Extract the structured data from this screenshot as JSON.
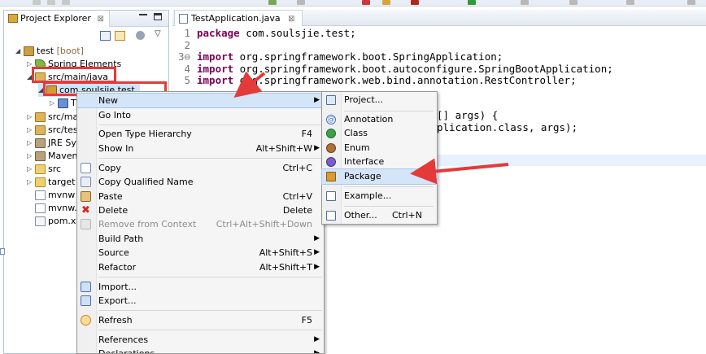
{
  "explorer": {
    "tab_label": "Project Explorer",
    "close_glyph": "⊠",
    "tree": [
      {
        "id": "project",
        "label": "test",
        "suffix": " [boot]",
        "arrow": "◢",
        "icon": "project-icon"
      },
      {
        "id": "spring-elements",
        "label": "Spring Elements",
        "arrow": "▷",
        "icon": "spring-leaf-icon"
      },
      {
        "id": "src-main-java",
        "label": "src/main/java",
        "arrow": "◢",
        "icon": "source-folder-icon"
      },
      {
        "id": "package",
        "label": "com.soulsjie.test",
        "arrow": "◢",
        "icon": "package-icon"
      },
      {
        "id": "class-file",
        "label": "T",
        "arrow": "▷",
        "icon": "java-file-icon"
      },
      {
        "id": "src-main-2",
        "label": "src/mai",
        "arrow": "▷",
        "icon": "source-folder-icon"
      },
      {
        "id": "src-test",
        "label": "src/test",
        "arrow": "▷",
        "icon": "source-folder-icon"
      },
      {
        "id": "jre",
        "label": "JRE Sys",
        "arrow": "▷",
        "icon": "library-icon"
      },
      {
        "id": "maven",
        "label": "Maven",
        "arrow": "▷",
        "icon": "library-icon"
      },
      {
        "id": "src",
        "label": "src",
        "arrow": "▷",
        "icon": "folder-icon"
      },
      {
        "id": "target",
        "label": "target",
        "arrow": "▷",
        "icon": "folder-icon"
      },
      {
        "id": "mvnw",
        "label": "mvnw",
        "arrow": "",
        "icon": "file-icon"
      },
      {
        "id": "mvnw-cmd",
        "label": "mvnw.c",
        "arrow": "",
        "icon": "file-icon"
      },
      {
        "id": "pom",
        "label": "pom.xm",
        "arrow": "",
        "icon": "xml-file-icon"
      }
    ]
  },
  "editor": {
    "tab_label": "TestApplication.java",
    "close_glyph": "⊠",
    "lines": [
      {
        "n": "1",
        "kw": "package",
        "text": " com.soulsjie.test;"
      },
      {
        "n": "2",
        "kw": "",
        "text": ""
      },
      {
        "n": "3⊖",
        "kw": "import",
        "text": " org.springframework.boot.SpringApplication;"
      },
      {
        "n": "4",
        "kw": "import",
        "text": " org.springframework.boot.autoconfigure.SpringBootApplication;"
      },
      {
        "n": "5",
        "kw": "import",
        "text": " org.springframework.web.bind.annotation.RestController;"
      },
      {
        "n": "",
        "kw": "",
        "text": "[] args) {"
      },
      {
        "n": "",
        "kw": "",
        "text": "plication.class, args);"
      }
    ]
  },
  "context_menu": {
    "items": [
      {
        "label": "New",
        "accel": "",
        "submenu": true,
        "state": "active",
        "icon": ""
      },
      {
        "label": "Go Into",
        "accel": "",
        "submenu": false,
        "state": "normal",
        "icon": ""
      },
      {
        "label": "Open Type Hierarchy",
        "accel": "F4",
        "submenu": false,
        "state": "normal",
        "icon": ""
      },
      {
        "label": "Show In",
        "accel": "Alt+Shift+W",
        "submenu": true,
        "state": "normal",
        "icon": ""
      },
      {
        "label": "Copy",
        "accel": "Ctrl+C",
        "submenu": false,
        "state": "normal",
        "icon": "copy-icon"
      },
      {
        "label": "Copy Qualified Name",
        "accel": "",
        "submenu": false,
        "state": "normal",
        "icon": "copy-qualified-icon"
      },
      {
        "label": "Paste",
        "accel": "Ctrl+V",
        "submenu": false,
        "state": "normal",
        "icon": "paste-icon"
      },
      {
        "label": "Delete",
        "accel": "Delete",
        "submenu": false,
        "state": "normal",
        "icon": "delete-icon"
      },
      {
        "label": "Remove from Context",
        "accel": "Ctrl+Alt+Shift+Down",
        "submenu": false,
        "state": "disabled",
        "icon": "remove-context-icon"
      },
      {
        "label": "Build Path",
        "accel": "",
        "submenu": true,
        "state": "normal",
        "icon": ""
      },
      {
        "label": "Source",
        "accel": "Alt+Shift+S",
        "submenu": true,
        "state": "normal",
        "icon": ""
      },
      {
        "label": "Refactor",
        "accel": "Alt+Shift+T",
        "submenu": true,
        "state": "normal",
        "icon": ""
      },
      {
        "label": "Import...",
        "accel": "",
        "submenu": false,
        "state": "normal",
        "icon": "import-icon"
      },
      {
        "label": "Export...",
        "accel": "",
        "submenu": false,
        "state": "normal",
        "icon": "export-icon"
      },
      {
        "label": "Refresh",
        "accel": "F5",
        "submenu": false,
        "state": "normal",
        "icon": "refresh-icon"
      },
      {
        "label": "References",
        "accel": "",
        "submenu": true,
        "state": "normal",
        "icon": ""
      },
      {
        "label": "Declarations",
        "accel": "",
        "submenu": true,
        "state": "normal",
        "icon": ""
      }
    ]
  },
  "new_submenu": {
    "items": [
      {
        "label": "Project...",
        "accel": "",
        "icon": "new-project-icon"
      },
      {
        "label": "Annotation",
        "accel": "",
        "icon": "annotation-icon"
      },
      {
        "label": "Class",
        "accel": "",
        "icon": "class-icon"
      },
      {
        "label": "Enum",
        "accel": "",
        "icon": "enum-icon"
      },
      {
        "label": "Interface",
        "accel": "",
        "icon": "interface-icon"
      },
      {
        "label": "Package",
        "accel": "",
        "icon": "package-icon"
      },
      {
        "label": "Example...",
        "accel": "",
        "icon": "example-icon"
      },
      {
        "label": "Other...",
        "accel": "Ctrl+N",
        "icon": "other-wizard-icon"
      }
    ]
  },
  "annotation_color": "#e43a3a"
}
